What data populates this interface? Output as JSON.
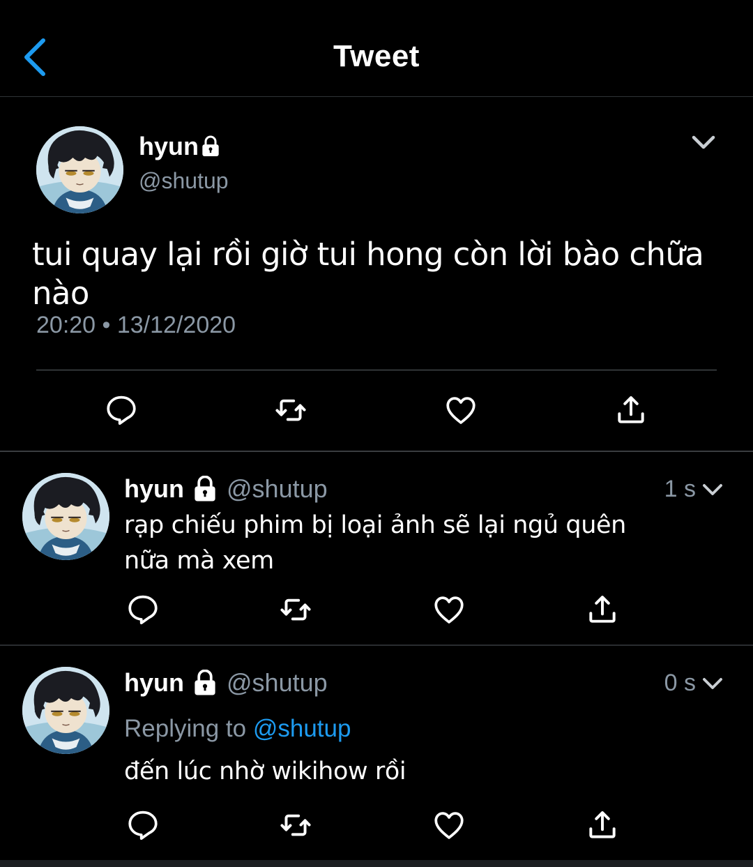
{
  "header": {
    "title": "Tweet",
    "back_icon": "chevron-left-icon",
    "accent": "#1d9bf0"
  },
  "main_tweet": {
    "name": "hyun",
    "handle": "@shutup",
    "protected": true,
    "text": "tui quay lại rồi giờ tui hong còn lời bào chữa nào",
    "timestamp": "20:20 • 13/12/2020",
    "actions": [
      "reply-icon",
      "retweet-icon",
      "like-icon",
      "share-icon"
    ]
  },
  "replies": [
    {
      "name": "hyun",
      "handle": "@shutup",
      "protected": true,
      "time": "1 s",
      "text": "rạp chiếu phim bị loại ảnh sẽ lại ngủ quên nữa mà xem",
      "actions": [
        "reply-icon",
        "retweet-icon",
        "like-icon",
        "share-icon"
      ]
    },
    {
      "name": "hyun",
      "handle": "@shutup",
      "protected": true,
      "time": "0 s",
      "replying_label": "Replying to",
      "replying_to": "@shutup",
      "text": "đến lúc nhờ wikihow rồi",
      "actions": [
        "reply-icon",
        "retweet-icon",
        "like-icon",
        "share-icon"
      ]
    }
  ],
  "colors": {
    "background": "#000000",
    "text_primary": "#ffffff",
    "text_secondary": "#8b98a5",
    "link": "#1d9bf0",
    "divider": "#2f3336"
  }
}
